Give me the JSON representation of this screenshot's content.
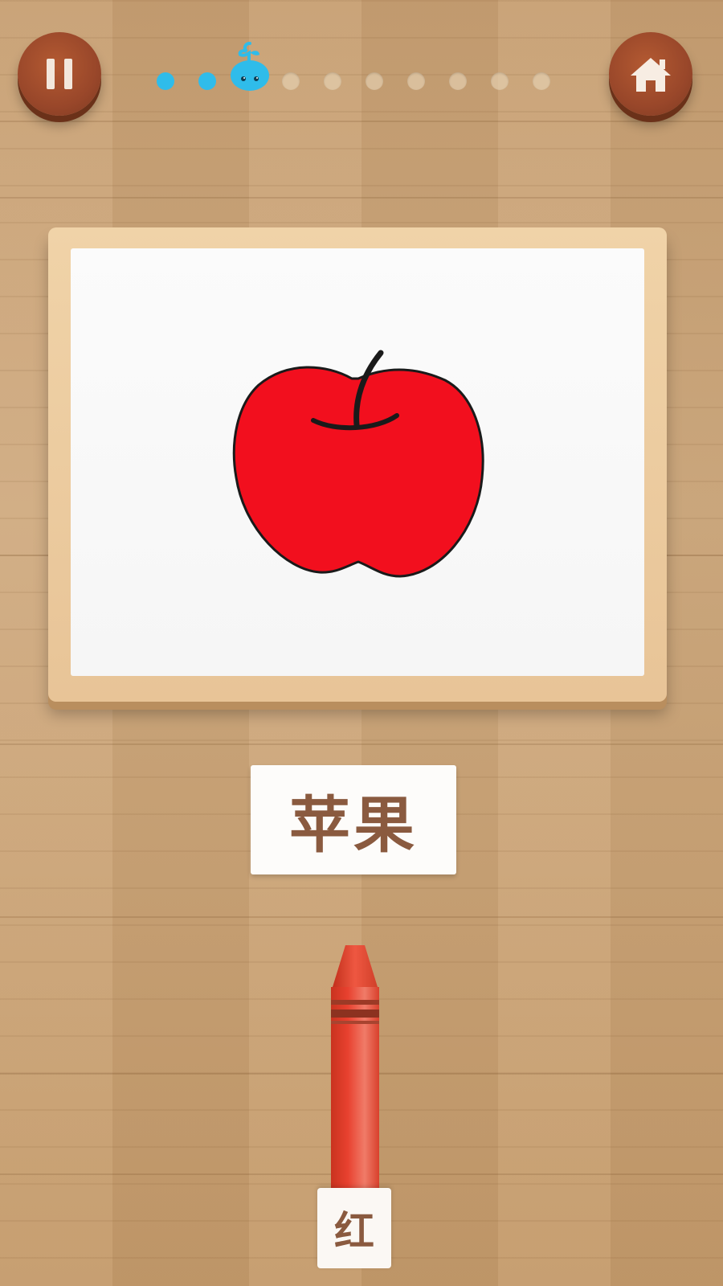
{
  "header": {
    "pause_icon": "pause-icon",
    "home_icon": "home-icon",
    "progress": {
      "total_steps": 10,
      "completed": 2,
      "current_step": 3,
      "current_marker": "whale-icon",
      "colors": {
        "done": "#2fbcea",
        "todo": "#e6d2b4"
      }
    }
  },
  "card": {
    "picture": "apple",
    "picture_colors": {
      "fill": "#f20f1e",
      "outline": "#1a1a1a"
    },
    "word": "苹果"
  },
  "crayon": {
    "color_name": "红",
    "color": "#e8412f"
  }
}
